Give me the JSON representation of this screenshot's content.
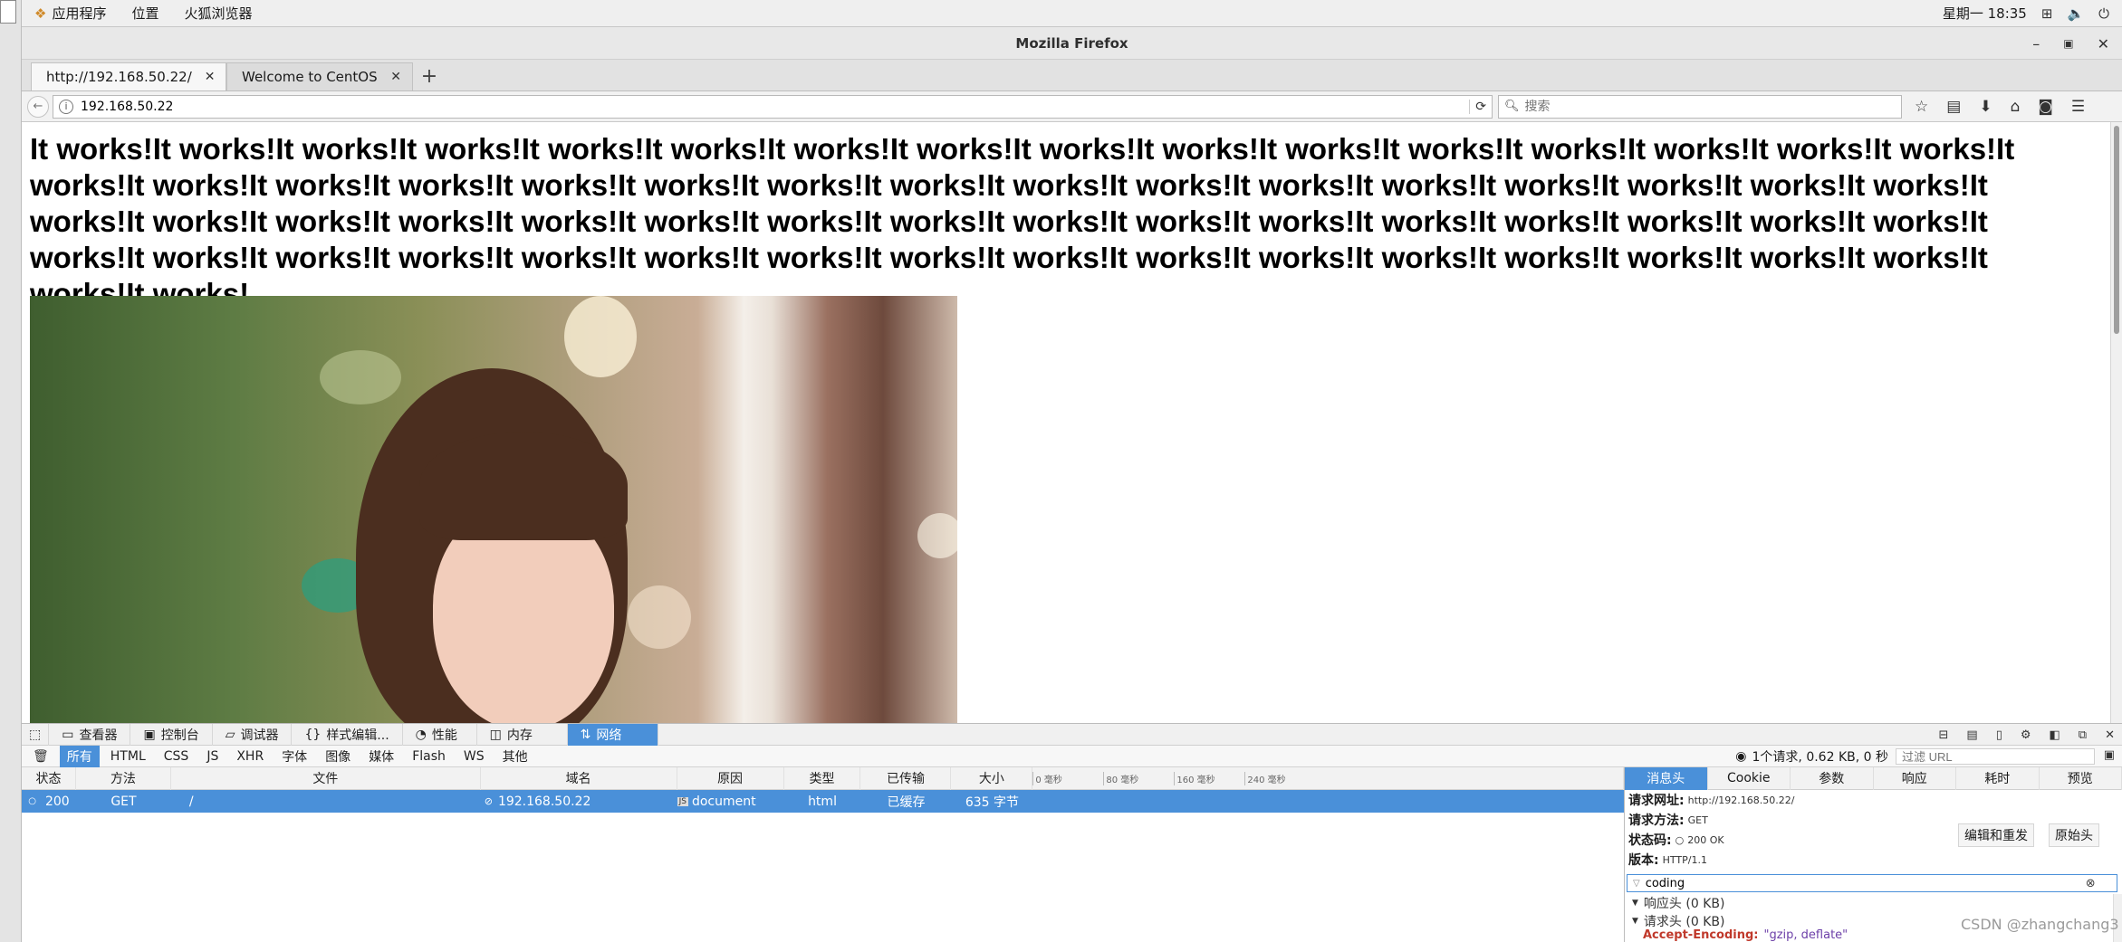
{
  "topbar": {
    "menus": [
      "应用程序",
      "位置",
      "火狐浏览器"
    ],
    "clock": "星期一 18:35"
  },
  "window": {
    "title": "Mozilla Firefox"
  },
  "tabs": [
    {
      "label": "http://192.168.50.22/",
      "active": true
    },
    {
      "label": "Welcome to CentOS",
      "active": false
    }
  ],
  "nav": {
    "url": "192.168.50.22",
    "search_placeholder": "搜索"
  },
  "page": {
    "heading": "It works!It works!It works!It works!It works!It works!It works!It works!It works!It works!It works!It works!It works!It works!It works!It works!It works!It works!It works!It works!It works!It works!It works!It works!It works!It works!It works!It works!It works!It works!It works!It works!It works!It works!It works!It works!It works!It works!It works!It works!It works!It works!It works!It works!It works!It works!It works!It works!It works!It works!It works!It works!It works!It works!It works!It works!It works!It works!It works!It works!It works!It works!It works!It works!It works!It works!"
  },
  "devtools": {
    "tools": [
      "查看器",
      "控制台",
      "调试器",
      "样式编辑...",
      "性能",
      "内存",
      "网络"
    ],
    "active_tool": "网络",
    "filters": [
      "所有",
      "HTML",
      "CSS",
      "JS",
      "XHR",
      "字体",
      "图像",
      "媒体",
      "Flash",
      "WS",
      "其他"
    ],
    "active_filter": "所有",
    "summary": "1个请求, 0.62 KB, 0 秒",
    "url_filter_placeholder": "过滤 URL",
    "columns": [
      "状态",
      "方法",
      "文件",
      "域名",
      "原因",
      "类型",
      "已传输",
      "大小"
    ],
    "timeline_ticks": [
      "0 毫秒",
      "80 毫秒",
      "160 毫秒",
      "240 毫秒"
    ],
    "requests": [
      {
        "status": "200",
        "method": "GET",
        "file": "/",
        "domain": "192.168.50.22",
        "cause": "document",
        "type": "html",
        "transferred": "已缓存",
        "size": "635 字节"
      }
    ],
    "details": {
      "tabs": [
        "消息头",
        "Cookie",
        "参数",
        "响应",
        "耗时",
        "预览"
      ],
      "active_tab": "消息头",
      "request_url_label": "请求网址:",
      "request_url": "http://192.168.50.22/",
      "method_label": "请求方法:",
      "method": "GET",
      "status_label": "状态码:",
      "status": "200 OK",
      "version_label": "版本:",
      "version": "HTTP/1.1",
      "edit_resend": "编辑和重发",
      "raw_headers": "原始头",
      "search_value": "coding",
      "response_headers": "响应头 (0 KB)",
      "request_headers": "请求头 (0 KB)",
      "accept_encoding_key": "Accept-Encoding:",
      "accept_encoding_value": "\"gzip, deflate\""
    }
  },
  "watermark": "CSDN @zhangchang3"
}
